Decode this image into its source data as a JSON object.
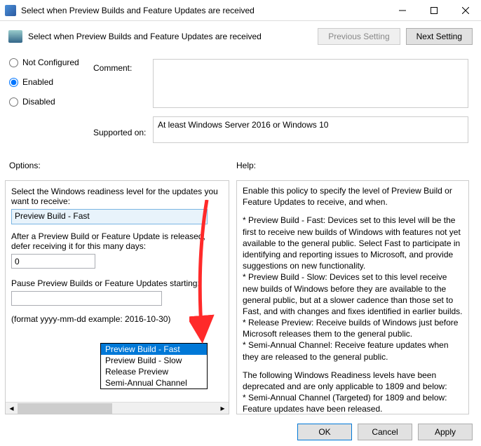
{
  "title": "Select when Preview Builds and Feature Updates are received",
  "header_text": "Select when Preview Builds and Feature Updates are received",
  "buttons": {
    "prev_setting": "Previous Setting",
    "next_setting": "Next Setting",
    "ok": "OK",
    "cancel": "Cancel",
    "apply": "Apply"
  },
  "radios": {
    "not_configured": "Not Configured",
    "enabled": "Enabled",
    "disabled": "Disabled",
    "selected": "enabled"
  },
  "labels": {
    "comment": "Comment:",
    "supported_on": "Supported on:",
    "options": "Options:",
    "help": "Help:"
  },
  "supported_on_text": "At least Windows Server 2016 or Windows 10",
  "options": {
    "select_label": "Select the Windows readiness level for the updates you want to receive:",
    "select_value": "Preview Build - Fast",
    "defer_label": "After a Preview Build or Feature Update is released, defer receiving it for this many days:",
    "defer_value": "0",
    "pause_label": "Pause Preview Builds or Feature Updates starting:",
    "pause_value": "",
    "format_hint": "(format yyyy-mm-dd  example: 2016-10-30)",
    "dropdown_items": [
      "Preview Build - Fast",
      "Preview Build - Slow",
      "Release Preview",
      "Semi-Annual Channel"
    ]
  },
  "help_text": {
    "p1": "Enable this policy to specify the level of Preview Build or Feature Updates to receive, and when.",
    "p2": "* Preview Build - Fast: Devices set to this level will be the first to receive new builds of Windows with features not yet available to the general public. Select Fast to participate in identifying and reporting issues to Microsoft, and provide suggestions on new functionality.",
    "p3": "* Preview Build - Slow: Devices set to this level receive new builds of Windows before they are available to the general public, but at a slower cadence than those set to Fast, and with changes and fixes identified in earlier builds.",
    "p4": "* Release Preview: Receive builds of Windows just before Microsoft releases them to the general public.",
    "p5": "* Semi-Annual Channel: Receive feature updates when they are released to the general public.",
    "p6": "The following Windows Readiness levels have been deprecated and are only applicable to 1809 and below:",
    "p7": "* Semi-Annual Channel (Targeted) for 1809 and below: Feature updates have been released."
  }
}
